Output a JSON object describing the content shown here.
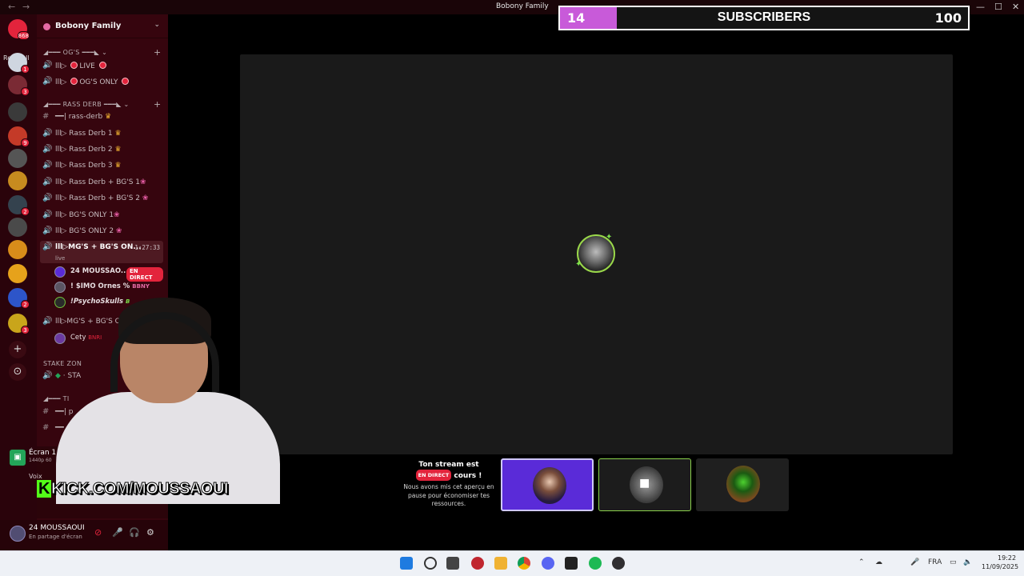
{
  "titlebar": {
    "title": "Bobony Family",
    "back": "←",
    "forward": "→",
    "minimize": "—",
    "maximize": "☐",
    "close": "✕"
  },
  "rail": {
    "unread_count": "868",
    "read_all": "Read All",
    "add": "+",
    "explore": "⊙"
  },
  "server": {
    "name": "Bobony Family"
  },
  "categories": [
    {
      "label": "◢━━━ OG'S ━━━◣ ⌄"
    },
    {
      "label": "◢━━━ RASS DERB ━━━◣ ⌄"
    },
    {
      "label": "STAKE ZON"
    },
    {
      "label": "◢━━━ TI"
    }
  ],
  "channels": {
    "live": "lll▷",
    "live2": "LIVE",
    "ogs_only_a": "lll▷",
    "ogs_only_b": "OG'S ONLY",
    "rass_text": "━━| rass-derb",
    "rass1": "lll▷ Rass Derb 1",
    "rass2": "lll▷ Rass Derb 2",
    "rass3": "lll▷ Rass Derb 3",
    "rassbg1": "lll▷ Rass Derb + BG'S 1",
    "rassbg2": "lll▷ Rass Derb + BG'S 2",
    "bgs1": "lll▷ BG'S ONLY 1",
    "bgs2": "lll▷ BG'S ONLY 2",
    "mgbg_active": "lll▷MG'S + BG'S ON...",
    "mgbg_timer": "1:27:33",
    "mgbg_sub": "live",
    "mgbg_other": "lll▷MG'S + BG'S O",
    "stake_item": "· STA",
    "ti_item1": "━━| p",
    "ti_item2": "━━"
  },
  "voice_users": [
    {
      "name": "24 MOUSSAO...",
      "badge": "EN DIRECT"
    },
    {
      "name": "! $IMO Ornes %",
      "tag": "BBNY"
    },
    {
      "name": "!PsychoSkulls",
      "tag": "B"
    },
    {
      "name": "Cety",
      "tag": "BNRI"
    }
  ],
  "voice_panel": {
    "screen_title": "Écran 1",
    "screen_sub": "1440p 60",
    "voice_label": "Voix"
  },
  "user": {
    "name": "24 MOUSSAOUI",
    "status": "En partage d'écran"
  },
  "subgoal": {
    "current": "14",
    "label": "SUBSCRIBERS",
    "goal": "100",
    "fill_fraction": 0.14,
    "fill_color": "#c85ad9"
  },
  "notice": {
    "headline_a": "Ton stream est",
    "badge": "EN DIRECT",
    "headline_b": "cours !",
    "body": "Nous avons mis cet aperçu en pause pour économiser tes ressources."
  },
  "overlay": {
    "kick_k": "K",
    "kick_text": "KICK.COM/MOUSSAOUI"
  },
  "taskbar": {
    "lang": "FRA",
    "time": "19:22",
    "date": "11/09/2025",
    "icons": [
      "windows-start-icon",
      "search-icon",
      "task-view-icon",
      "app-icon",
      "file-explorer-icon",
      "chrome-icon",
      "discord-icon",
      "app-icon",
      "spotify-icon",
      "obs-icon"
    ]
  },
  "colors": {
    "accent_live": "#e3243c",
    "sidebar": "#36050e",
    "rail": "#2a030b",
    "kick_green": "#53fc18"
  }
}
